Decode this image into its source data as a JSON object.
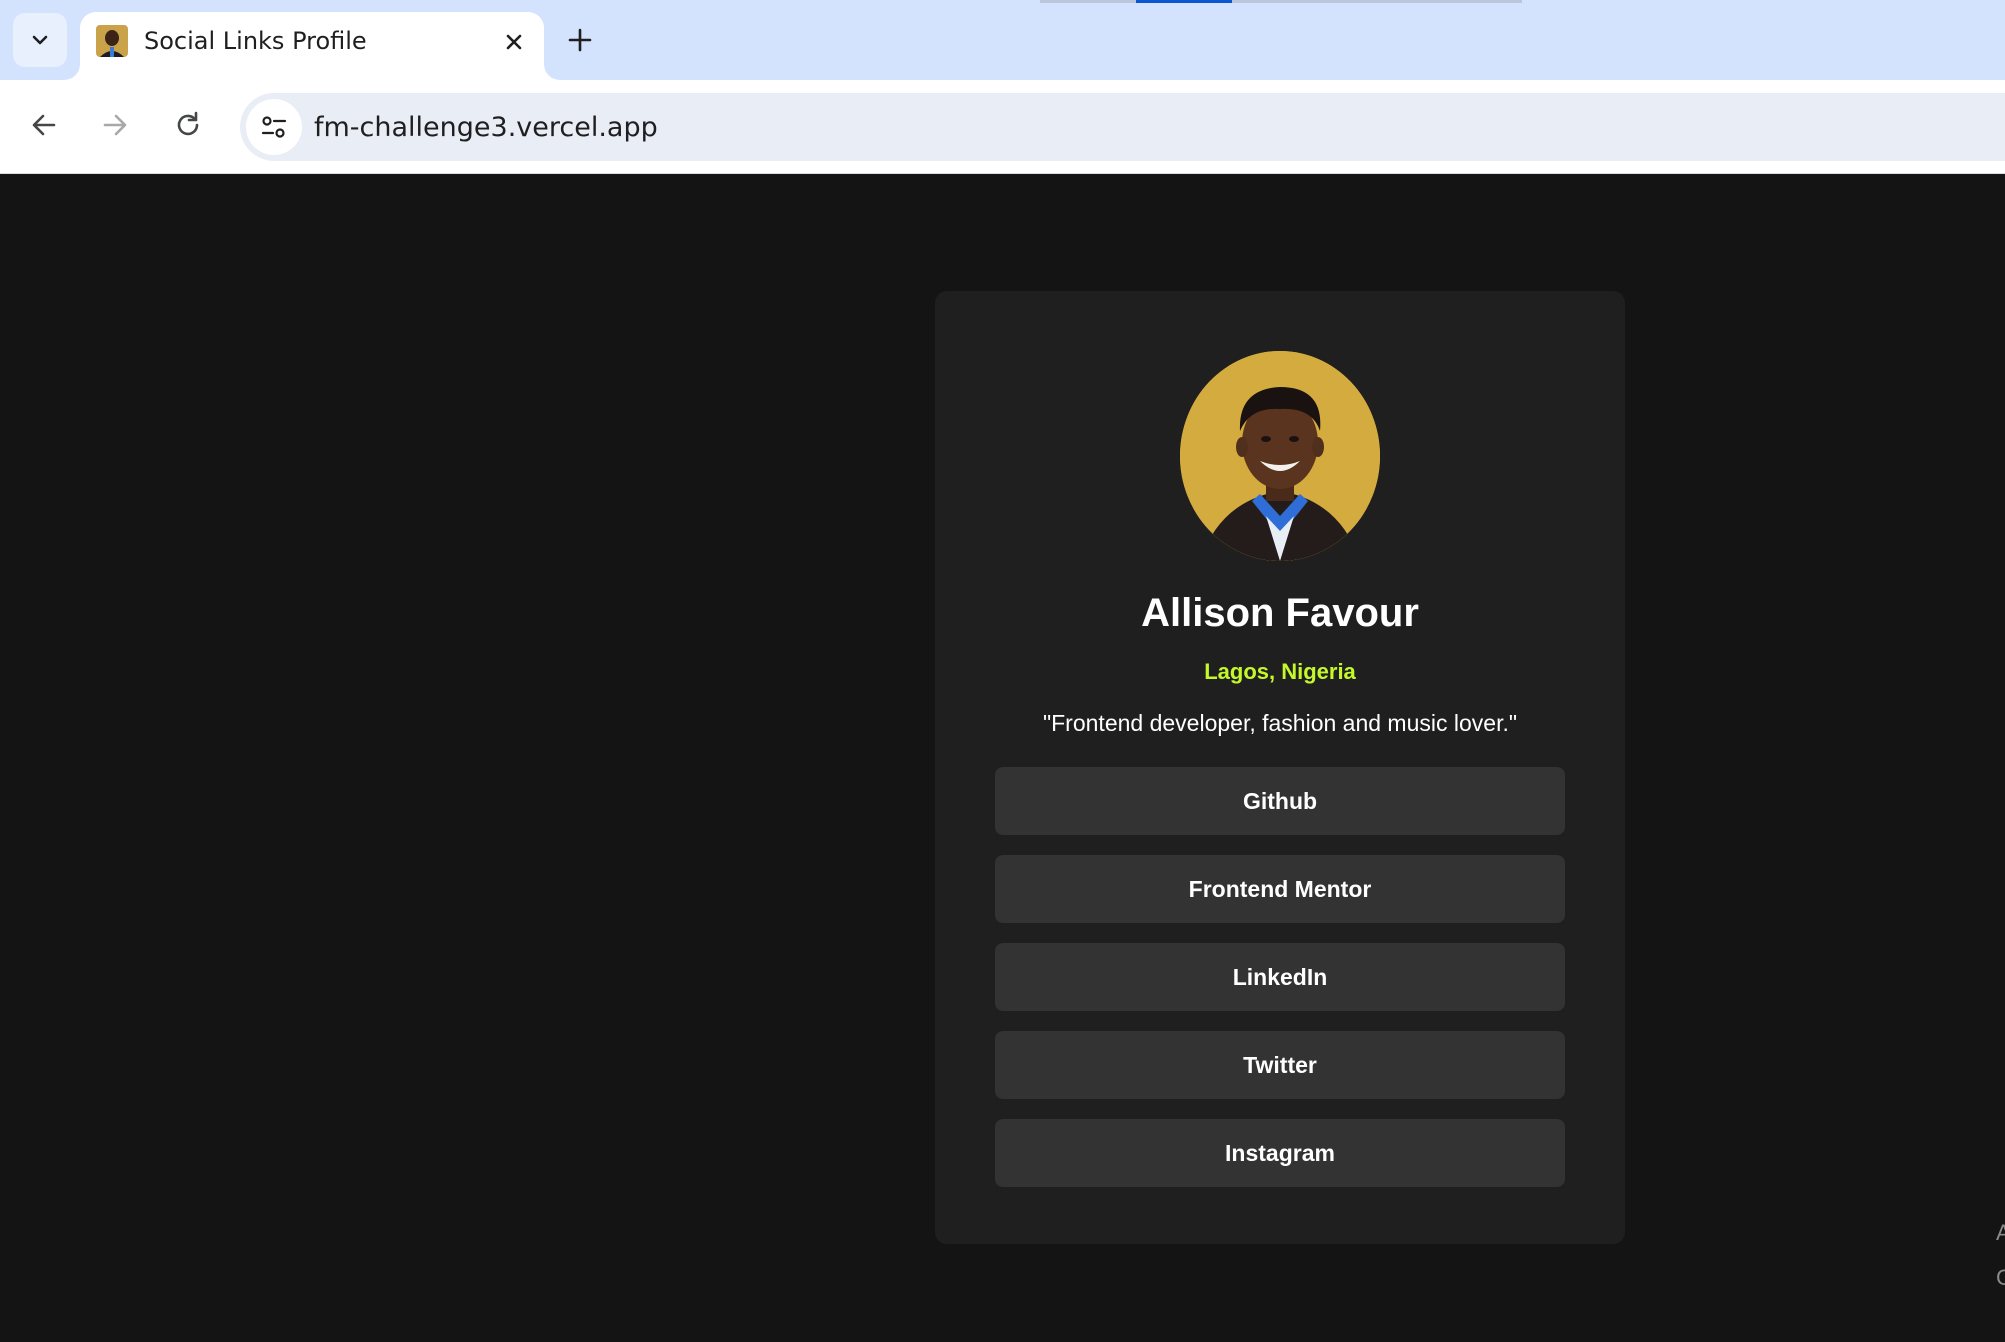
{
  "browser": {
    "tab_title": "Social Links Profile",
    "url": "fm-challenge3.vercel.app"
  },
  "profile": {
    "name": "Allison Favour",
    "location": "Lagos, Nigeria",
    "bio": "\"Frontend developer, fashion and music lover.\"",
    "links": [
      "Github",
      "Frontend Mentor",
      "LinkedIn",
      "Twitter",
      "Instagram"
    ]
  },
  "edge_text": [
    "A",
    "C"
  ],
  "colors": {
    "page_bg": "#141414",
    "card_bg": "#1f1f1f",
    "button_bg": "#333333",
    "accent_green": "#c4f82a",
    "tabstrip_bg": "#d3e3fd"
  },
  "icons": [
    "tab-search-icon",
    "favicon-avatar",
    "close-icon",
    "plus-icon",
    "back-icon",
    "forward-icon",
    "reload-icon",
    "site-settings-icon"
  ]
}
